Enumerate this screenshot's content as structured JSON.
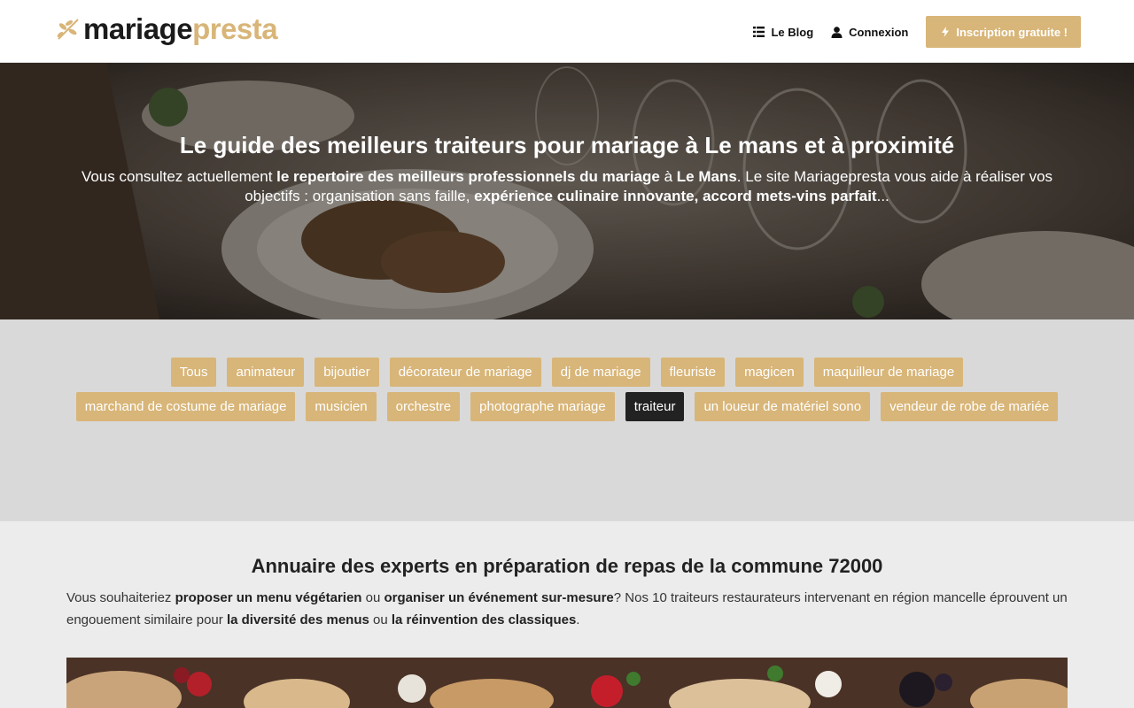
{
  "header": {
    "logo": {
      "part1": "mariage",
      "part2": "presta"
    },
    "nav": {
      "blog_label": "Le Blog",
      "login_label": "Connexion",
      "signup_label": "Inscription gratuite !"
    }
  },
  "hero": {
    "title": "Le guide des meilleurs traiteurs pour mariage à Le mans et à proximité",
    "intro": [
      {
        "t": "Vous consultez actuellement ",
        "b": false
      },
      {
        "t": "le repertoire des meilleurs professionnels du mariage",
        "b": true
      },
      {
        "t": " à ",
        "b": false
      },
      {
        "t": "Le Mans",
        "b": true
      },
      {
        "t": ". Le site Mariagepresta vous aide à réaliser vos objectifs : organisation sans faille, ",
        "b": false
      },
      {
        "t": "expérience culinaire innovante, accord mets-vins parfait",
        "b": true
      },
      {
        "t": "...",
        "b": false
      }
    ]
  },
  "filters": {
    "active": "traiteur",
    "row1": [
      "Tous",
      "animateur",
      "bijoutier",
      "décorateur de mariage",
      "dj de mariage",
      "fleuriste",
      "magicen",
      "maquilleur de mariage"
    ],
    "row2": [
      "marchand de costume de mariage",
      "musicien",
      "orchestre",
      "photographe mariage",
      "traiteur",
      "un loueur de matériel sono",
      "vendeur de robe de mariée"
    ]
  },
  "directory": {
    "title": "Annuaire des experts en préparation de repas de la commune 72000",
    "text": [
      {
        "t": "Vous souhaiteriez ",
        "b": false
      },
      {
        "t": "proposer un menu végétarien",
        "b": true
      },
      {
        "t": " ou ",
        "b": false
      },
      {
        "t": "organiser un événement sur-mesure",
        "b": true
      },
      {
        "t": "? Nos 10 traiteurs restaurateurs intervenant en région mancelle éprouvent un engouement similaire pour ",
        "b": false
      },
      {
        "t": "la diversité des menus",
        "b": true
      },
      {
        "t": " ou ",
        "b": false
      },
      {
        "t": "la réinvention des classiques",
        "b": true
      },
      {
        "t": ".",
        "b": false
      }
    ]
  },
  "colors": {
    "accent": "#d8b578",
    "active_tag": "#222222",
    "filters_bg": "#d9d9d9",
    "section_bg": "#ececec"
  },
  "icons": {
    "blog": "list-icon",
    "login": "user-icon",
    "signup": "bolt-icon"
  }
}
